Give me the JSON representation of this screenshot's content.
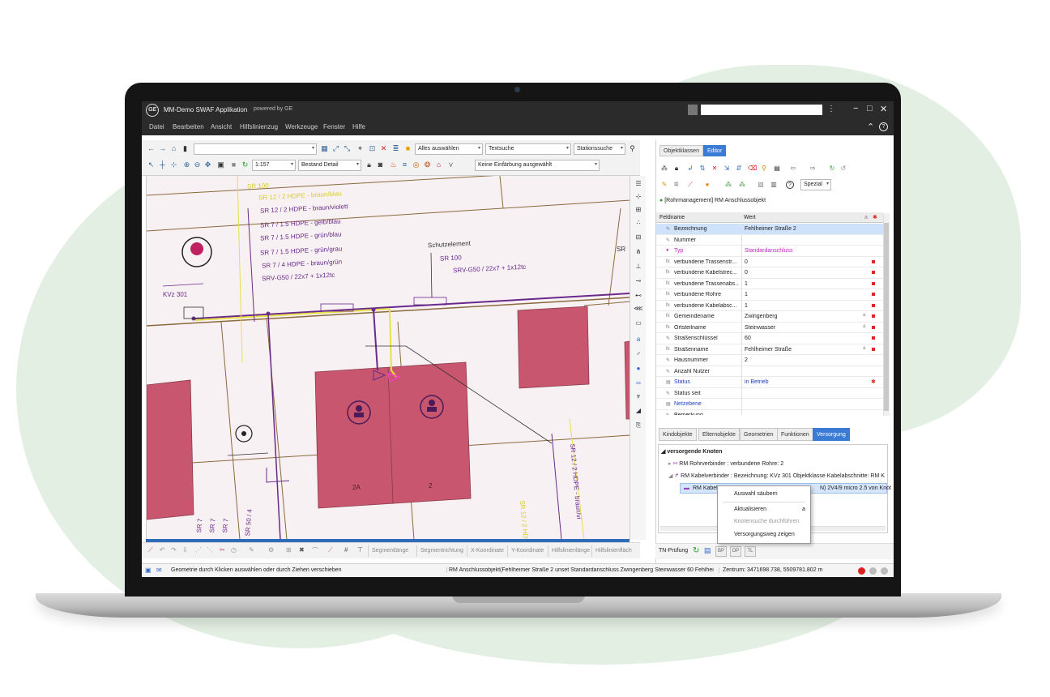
{
  "window": {
    "title": "MM-Demo SWAF Applikation",
    "powered_by": "powered by GE",
    "logo_text": "GE"
  },
  "menu": [
    "Datei",
    "Bearbeiten",
    "Ansicht",
    "Hilfslinienzug",
    "Werkzeuge",
    "Fenster",
    "Hilfe"
  ],
  "toolbar": {
    "select_value": "Alles auswählen",
    "textsearch_value": "Textsuche",
    "stationsearch_value": "Stationssuche",
    "scale_value": "1:157",
    "detail_value": "Bestand Detail",
    "coloring_value": "Keine Einfärbung ausgewählt"
  },
  "map": {
    "labels": {
      "sr100_top": "SR 100",
      "cable1": "SR 12 / 2 HDPE - braun/blau",
      "cable2": "SR 12 / 2 HDPE - braun/violett",
      "cable3": "SR 7 / 1.5 HDPE - gelb/blau",
      "cable4": "SR 7 / 1.5 HDPE - grün/blau",
      "cable5": "SR 7 / 1.5 HDPE - grün/grau",
      "cable6": "SR 7 / 4 HDPE - braun/grün",
      "cable7": "SRV-G50 / 22x7 + 1x12tc",
      "schutz": "Schutzelement",
      "schutz_sr": "SR 100",
      "schutz_srv": "SRV-G50 / 22x7 + 1x12tc",
      "kvz": "KVz 301",
      "sr_right": "SR",
      "house_2a": "2A",
      "house_2": "2",
      "vert_yellow": "SR 12 / 2 HDPE - braun/vi",
      "vert_yellow2": "SR 12 / 2 HDPE - braun/bla",
      "bl1": "SR 7",
      "bl2": "SR 7",
      "bl3": "SR 7",
      "bl4": "SR 50 / 4"
    }
  },
  "bottom_tools": [
    "Segmentlänge",
    "Segmentrichtung",
    "X-Koordinate",
    "Y-Koordinate",
    "Hilfslinienlänge",
    "Hilfslinienfläch"
  ],
  "status": {
    "left": "Geometrie durch Klicken auswählen oder durch Ziehen verschieben",
    "mid": "RM Anschlussobjekt(Fehlheimer Straße 2 unset Standardanschluss Zwingenberg Steinwasser 60 Fehlhei...",
    "coords": "Zentrum: 3471698.738, 5509781.802  m"
  },
  "panel": {
    "tabs": [
      "Objektklassen",
      "Editor"
    ],
    "special_label": "Spezial",
    "object_title": "[Rohrmanagement] RM Anschlussobjekt",
    "col_field": "Feldname",
    "col_value": "Wert",
    "rows": [
      {
        "name": "Bezeichnung",
        "value": "Fehlheimer Straße 2",
        "icon": "✎",
        "mark": false,
        "hl": true
      },
      {
        "name": "Nummer",
        "value": "",
        "icon": "✎",
        "mark": false
      },
      {
        "name": "Typ",
        "value": "Standardanschluss",
        "icon": "●",
        "mark": false,
        "pink": true
      },
      {
        "name": "verbundene Trassenstr...",
        "value": "0",
        "icon": "fx",
        "mark": true
      },
      {
        "name": "verbundene Kabelstrec...",
        "value": "0",
        "icon": "fx",
        "mark": true
      },
      {
        "name": "verbundene Trassenabs...",
        "value": "1",
        "icon": "fx",
        "mark": true
      },
      {
        "name": "verbundene Rohre",
        "value": "1",
        "icon": "fx",
        "mark": true
      },
      {
        "name": "verbundene Kabelabsc...",
        "value": "1",
        "icon": "fx",
        "mark": true
      },
      {
        "name": "Gemeindename",
        "value": "Zwingenberg",
        "icon": "fx",
        "mark": true,
        "a": true
      },
      {
        "name": "Ortsteilname",
        "value": "Steinwasser",
        "icon": "fx",
        "mark": true,
        "a": true
      },
      {
        "name": "Straßenschlüssel",
        "value": "60",
        "icon": "✎",
        "mark": true
      },
      {
        "name": "Straßenname",
        "value": "Fehlheimer Straße",
        "icon": "fx",
        "mark": true,
        "a": true
      },
      {
        "name": "Hausnummer",
        "value": "2",
        "icon": "✎",
        "mark": false
      },
      {
        "name": "Anzahl Nutzer",
        "value": "",
        "icon": "✎",
        "mark": false
      },
      {
        "name": "Status",
        "value": "in Betrieb",
        "icon": "▤",
        "mark": false,
        "blue": true,
        "star": true
      },
      {
        "name": "Status seit",
        "value": "",
        "icon": "✎",
        "mark": false
      },
      {
        "name": "Netzebene",
        "value": "",
        "icon": "▤",
        "mark": false,
        "blue": true
      },
      {
        "name": "Bemerkung",
        "value": "",
        "icon": "✎",
        "mark": false
      }
    ],
    "bottom_tabs": [
      "Kindobjekte",
      "Elternobjekte",
      "Geometrien",
      "Funktionen",
      "Versorgung"
    ],
    "tree": {
      "root": "versorgende Knoten",
      "n1": "RM Rohrverbinder :  verbundene Rohre: 2",
      "n2": "RM Kabelverbinder :  Bezeichnung: KVz 301 Objektklasse Kabelabschnitte: RM K",
      "n3_left": "RM Kabel",
      "n3_right": "N) 2V4/9 micro 2.5 von Knot"
    },
    "tn_label": "TN-Prüfung",
    "tn_buttons": [
      "BP",
      "DP",
      "TL"
    ]
  },
  "context_menu": {
    "items": [
      "Auswahl säubern",
      "Aktualisieren",
      "Knotensuche durchführen",
      "Versorgungsweg zeigen"
    ],
    "has_sub": "a"
  }
}
